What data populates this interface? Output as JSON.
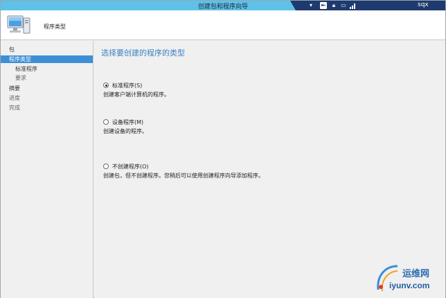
{
  "window": {
    "title": "创建包和程序向导",
    "remote_user": "sqx"
  },
  "header": {
    "title": "程序类型",
    "icon": "computer-monitor-icon"
  },
  "nav": {
    "items": [
      {
        "label": "包"
      },
      {
        "label": "程序类型"
      },
      {
        "label": "标准程序"
      },
      {
        "label": "要求"
      },
      {
        "label": "摘要"
      },
      {
        "label": "进度"
      },
      {
        "label": "完成"
      }
    ],
    "active_index": 1
  },
  "main": {
    "title": "选择要创建的程序的类型",
    "options": [
      {
        "label": "标准程序(S)",
        "description": "创建客户端计算机的程序。",
        "checked": true
      },
      {
        "label": "设备程序(M)",
        "description": "创建设备的程序。",
        "checked": false
      },
      {
        "label": "不创建程序(O)",
        "description": "创建包，但不创建程序。您稍后可以使用创建程序向导添加程序。",
        "checked": false
      }
    ]
  },
  "watermark": {
    "line1": "运维网",
    "line2": "iyunv.com"
  },
  "colors": {
    "titlebar": "#5ec1e8",
    "remote_bar": "#1e3a6e",
    "accent": "#3c8fd6",
    "heading": "#3a82c4"
  }
}
